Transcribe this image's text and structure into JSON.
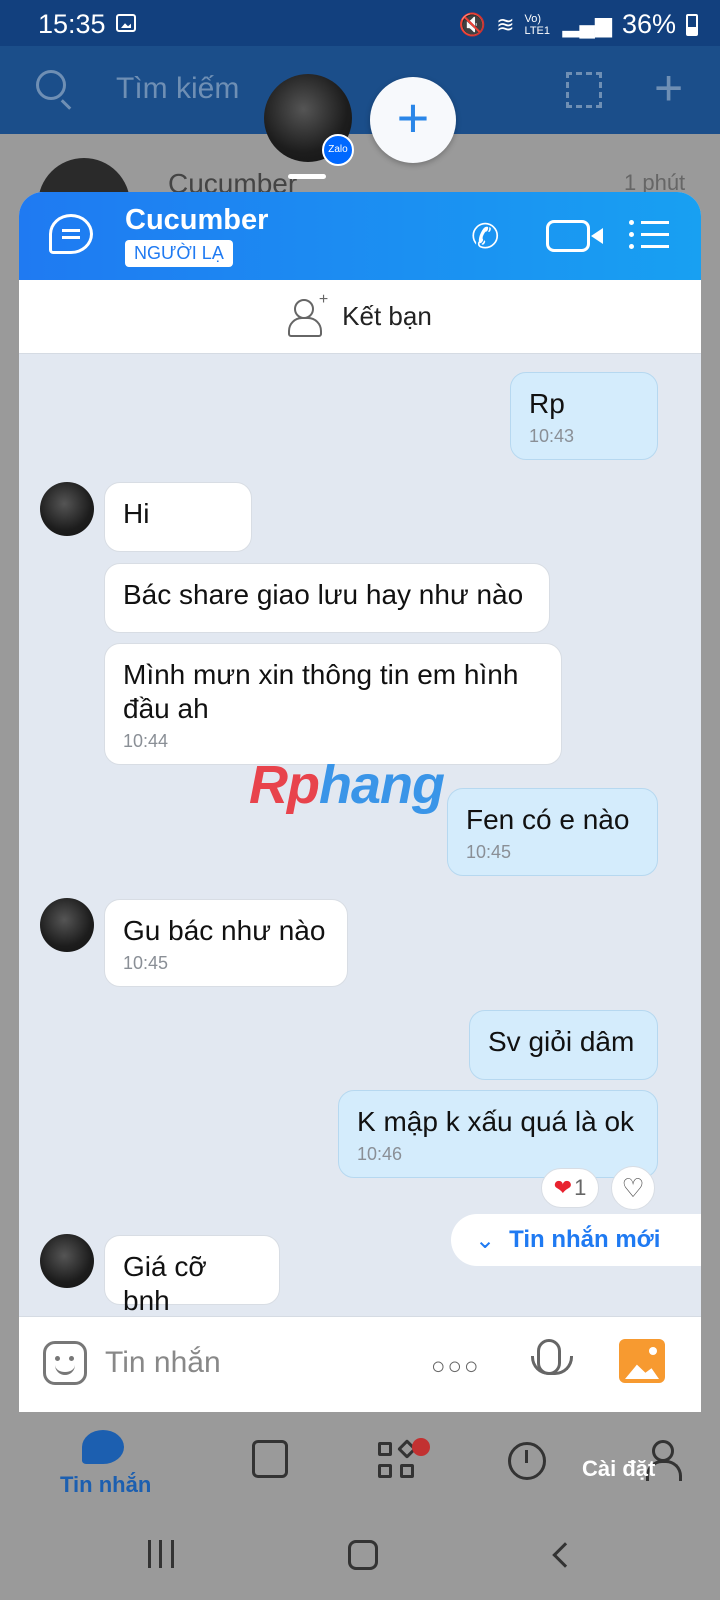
{
  "status_bar": {
    "time": "15:35",
    "network_label": "Vo) LTE1",
    "battery": "36%"
  },
  "background_app": {
    "search_placeholder": "Tìm kiếm",
    "list_row": {
      "name": "Cucumber",
      "time": "1 phút"
    },
    "bottom_nav": {
      "messages_label": "Tin nhắn",
      "settings_label": "Cài đặt"
    }
  },
  "floating": {
    "zalo_badge": "Zalo"
  },
  "chat": {
    "contact_name": "Cucumber",
    "contact_badge": "NGƯỜI LẠ",
    "add_friend_label": "Kết bạn",
    "messages": [
      {
        "dir": "out",
        "text": "Rp",
        "time": "10:43"
      },
      {
        "dir": "in",
        "text": "Hi",
        "time": ""
      },
      {
        "dir": "in",
        "text": "Bác share giao lưu hay như nào",
        "time": ""
      },
      {
        "dir": "in",
        "text": "Mình mưn xin thông tin em hình đầu ah",
        "time": "10:44"
      },
      {
        "dir": "out",
        "text": "Fen có e nào",
        "time": "10:45"
      },
      {
        "dir": "in",
        "text": "Gu bác như nào",
        "time": "10:45"
      },
      {
        "dir": "out",
        "text": "Sv giỏi dâm",
        "time": ""
      },
      {
        "dir": "out",
        "text": "K mập k xấu quá là ok",
        "time": "10:46"
      },
      {
        "dir": "in",
        "text": "Giá cỡ bnh",
        "time": ""
      }
    ],
    "reaction_count": "1",
    "new_messages_label": "Tin nhắn mới",
    "composer_placeholder": "Tin nhắn",
    "more_label": "○○○"
  },
  "watermark": {
    "part1": "Rp",
    "part2": "hang"
  },
  "colors": {
    "header_start": "#1f7af2",
    "header_end": "#18a0f2",
    "outgoing_bubble": "#d4ecfc",
    "accent": "#1f7af2"
  }
}
